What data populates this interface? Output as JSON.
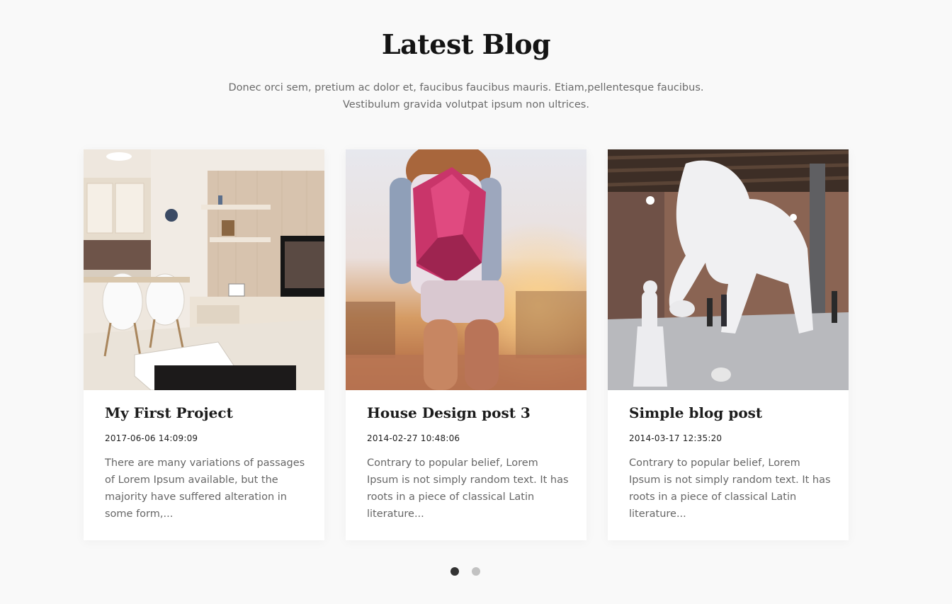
{
  "section": {
    "title": "Latest Blog",
    "subtitle": "Donec orci sem, pretium ac dolor et, faucibus faucibus mauris. Etiam,pellentesque faucibus. Vestibulum gravida volutpat ipsum non ultrices."
  },
  "posts": [
    {
      "title": "My First Project",
      "date": "2017-06-06 14:09:09",
      "excerpt": "There are many variations of passages of Lorem Ipsum available, but the majority have suffered alteration in some form,..."
    },
    {
      "title": "House Design post 3",
      "date": "2014-02-27 10:48:06",
      "excerpt": "Contrary to popular belief, Lorem Ipsum is not simply random text. It has roots in a piece of classical Latin literature..."
    },
    {
      "title": "Simple blog post",
      "date": "2014-03-17 12:35:20",
      "excerpt": "Contrary to popular belief, Lorem Ipsum is not simply random text. It has roots in a piece of classical Latin literature..."
    }
  ],
  "carousel": {
    "page_count": 2,
    "active_page": 1
  }
}
